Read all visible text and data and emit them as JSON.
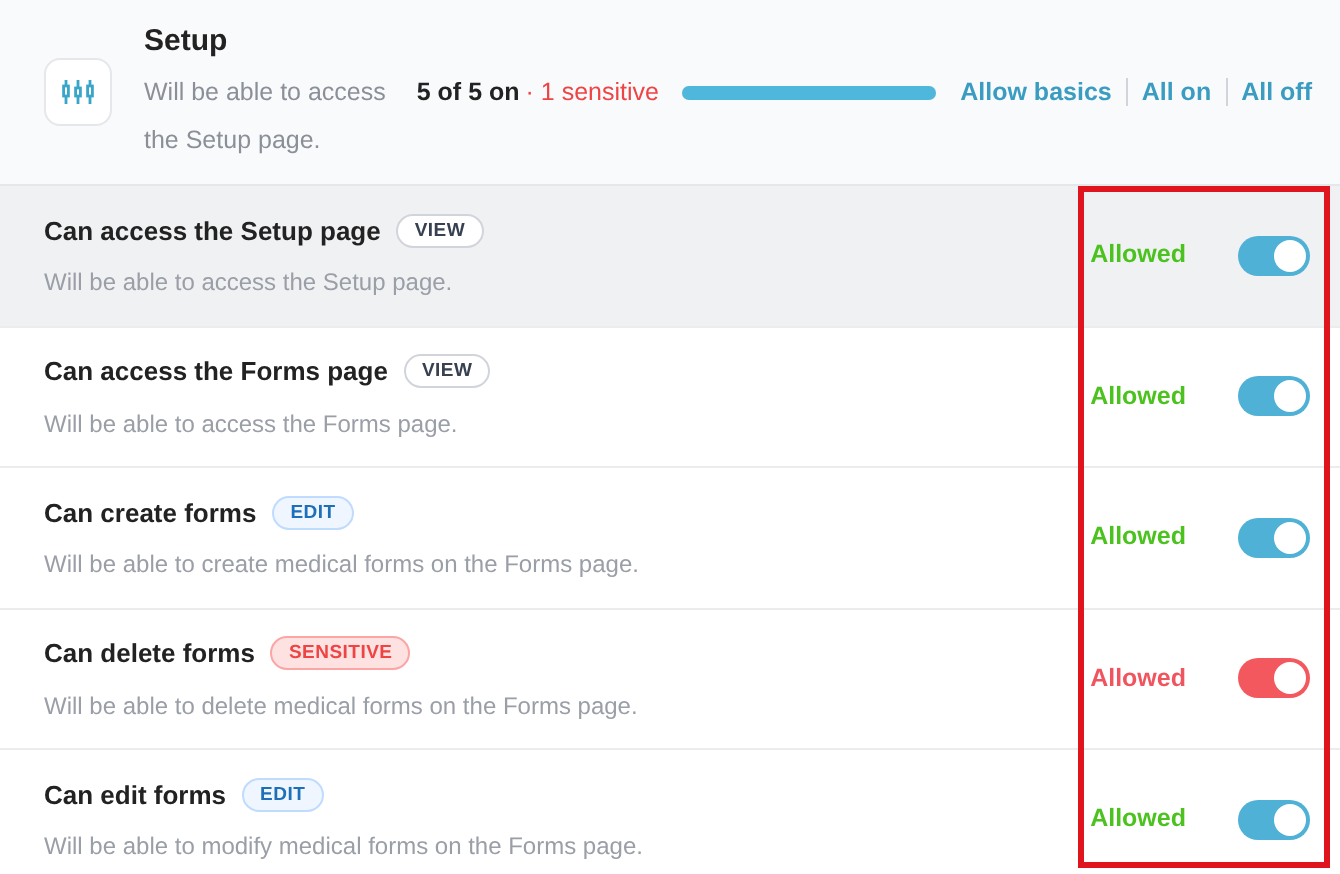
{
  "header": {
    "title": "Setup",
    "description": "Will be able to access the Setup page.",
    "count": "5 of 5 on",
    "sensitive_note": "· 1 sensitive",
    "progress": {
      "level": 1
    },
    "actions": [
      "Allow basics",
      "All on",
      "All off"
    ]
  },
  "permissions": [
    {
      "title": "Can access the Setup page",
      "tag": {
        "label": "VIEW",
        "kind": "view"
      },
      "description": "Will be able to access the Setup page.",
      "status": "Allowed",
      "on": true,
      "highlighted": true
    },
    {
      "title": "Can access the Forms page",
      "tag": {
        "label": "VIEW",
        "kind": "view"
      },
      "description": "Will be able to access the Forms page.",
      "status": "Allowed",
      "on": true,
      "highlighted": false
    },
    {
      "title": "Can create forms",
      "tag": {
        "label": "EDIT",
        "kind": "edit"
      },
      "description": "Will be able to create medical forms on the Forms page.",
      "status": "Allowed",
      "on": true,
      "highlighted": false
    },
    {
      "title": "Can delete forms",
      "tag": {
        "label": "SENSITIVE",
        "kind": "sensitive"
      },
      "description": "Will be able to delete medical forms on the Forms page.",
      "status": "Allowed",
      "on": true,
      "highlighted": false
    },
    {
      "title": "Can edit forms",
      "tag": {
        "label": "EDIT",
        "kind": "edit"
      },
      "description": "Will be able to modify medical forms on the Forms page.",
      "status": "Allowed",
      "on": true,
      "highlighted": false
    }
  ]
}
